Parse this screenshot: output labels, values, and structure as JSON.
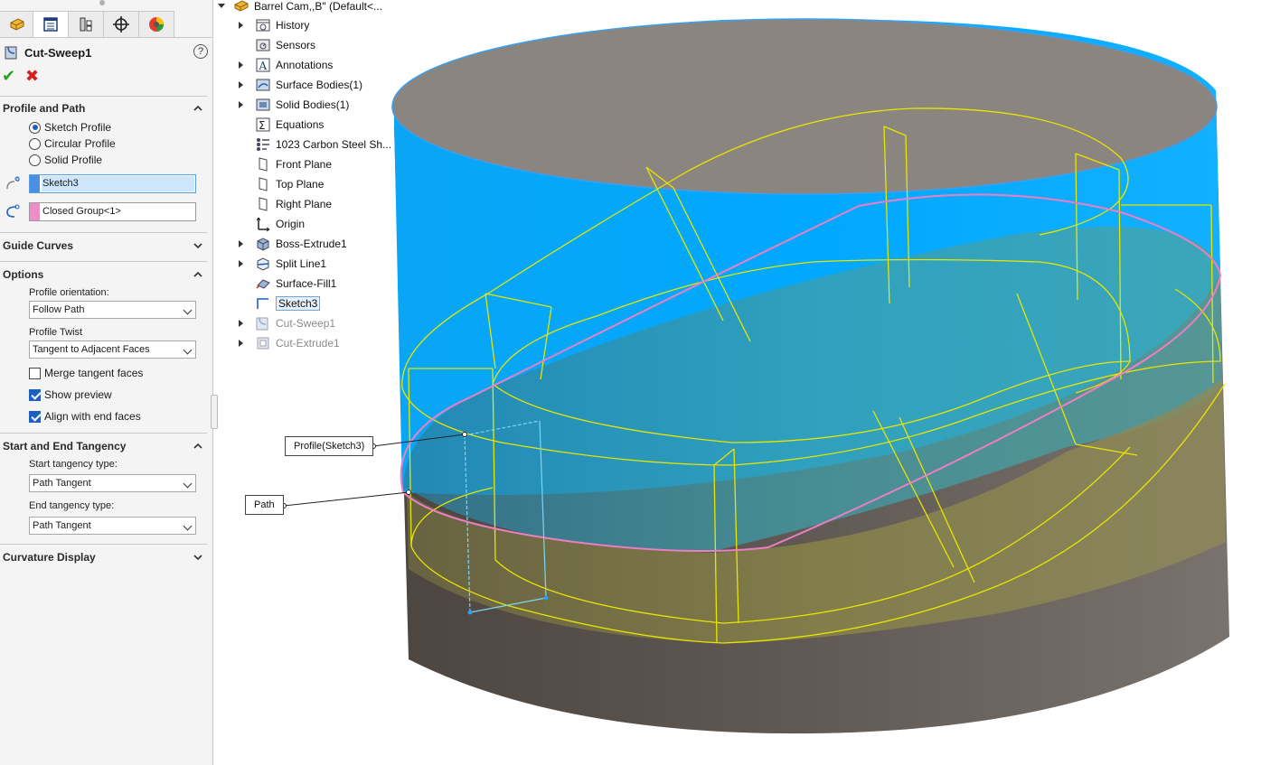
{
  "feature_name": "Cut-Sweep1",
  "help_symbol": "?",
  "profile_and_path": {
    "title": "Profile and Path",
    "options": [
      {
        "label": "Sketch Profile",
        "selected": true
      },
      {
        "label": "Circular Profile",
        "selected": false
      },
      {
        "label": "Solid Profile",
        "selected": false
      }
    ],
    "profile_value": "Sketch3",
    "path_value": "Closed Group<1>",
    "profile_color": "#4a90e2",
    "path_color": "#f08cc8"
  },
  "guide_curves": {
    "title": "Guide Curves"
  },
  "options_section": {
    "title": "Options",
    "profile_orientation_label": "Profile orientation:",
    "profile_orientation_value": "Follow Path",
    "profile_twist_label": "Profile Twist",
    "profile_twist_value": "Tangent to Adjacent Faces",
    "checks": [
      {
        "label": "Merge tangent faces",
        "checked": false
      },
      {
        "label": "Show preview",
        "checked": true
      },
      {
        "label": "Align with end faces",
        "checked": true
      }
    ]
  },
  "tangency": {
    "title": "Start and End Tangency",
    "start_label": "Start tangency type:",
    "start_value": "Path Tangent",
    "end_label": "End tangency type:",
    "end_value": "Path Tangent"
  },
  "curvature_display": {
    "title": "Curvature Display"
  },
  "tree": {
    "root": "Barrel Cam,,B\" (Default<...",
    "items": [
      {
        "label": "History",
        "icon": "history-icon",
        "expandable": true
      },
      {
        "label": "Sensors",
        "icon": "sensors-icon",
        "expandable": false
      },
      {
        "label": "Annotations",
        "icon": "annotations-icon",
        "expandable": true
      },
      {
        "label": "Surface Bodies(1)",
        "icon": "surface-bodies-icon",
        "expandable": true
      },
      {
        "label": "Solid Bodies(1)",
        "icon": "solid-bodies-icon",
        "expandable": true
      },
      {
        "label": "Equations",
        "icon": "equations-icon",
        "expandable": false
      },
      {
        "label": "1023 Carbon Steel Sh...",
        "icon": "material-icon",
        "expandable": false
      },
      {
        "label": "Front Plane",
        "icon": "plane-icon",
        "expandable": false
      },
      {
        "label": "Top Plane",
        "icon": "plane-icon",
        "expandable": false
      },
      {
        "label": "Right Plane",
        "icon": "plane-icon",
        "expandable": false
      },
      {
        "label": "Origin",
        "icon": "origin-icon",
        "expandable": false
      },
      {
        "label": "Boss-Extrude1",
        "icon": "boss-extrude-icon",
        "expandable": true
      },
      {
        "label": "Split Line1",
        "icon": "split-line-icon",
        "expandable": true
      },
      {
        "label": "Surface-Fill1",
        "icon": "surface-fill-icon",
        "expandable": false
      },
      {
        "label": "Sketch3",
        "icon": "sketch-icon",
        "expandable": false
      },
      {
        "label": "Cut-Sweep1",
        "icon": "cut-sweep-icon",
        "expandable": true
      },
      {
        "label": "Cut-Extrude1",
        "icon": "cut-extrude-icon",
        "expandable": true
      }
    ]
  },
  "callouts": {
    "profile": "Profile(Sketch3)",
    "path": "Path"
  },
  "colors": {
    "cylinder_blue": "#00a8ff",
    "cylinder_grey": "#6e6660",
    "preview_yellow": "#e6e600",
    "path_pink": "#ec7fc4"
  }
}
